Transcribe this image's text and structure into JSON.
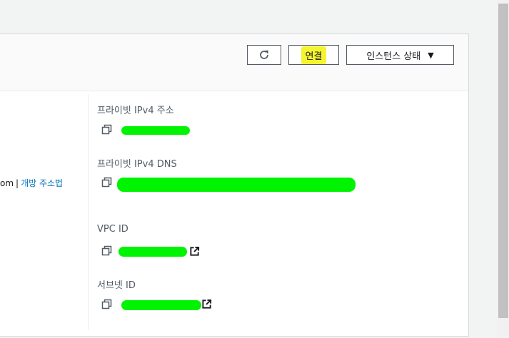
{
  "header": {
    "refresh_icon": "refresh-icon",
    "connect_label": "연결",
    "instance_state_label": "인스턴스 상태",
    "instance_state_caret": "▼"
  },
  "left_column": {
    "text_fragment": "om",
    "separator": "|",
    "open_address_link": "개방 주소법"
  },
  "details": {
    "private_ipv4_label": "프라이빗 IPv4 주소",
    "private_dns_label": "프라이빗 IPv4 DNS",
    "vpc_id_label": "VPC ID",
    "subnet_id_label": "서브넷 ID"
  },
  "icons": {
    "copy": "copy-icon",
    "external_link": "external-link-icon"
  },
  "colors": {
    "highlight": "#f4f430",
    "redaction": "#00f300",
    "link": "#0073bb"
  }
}
